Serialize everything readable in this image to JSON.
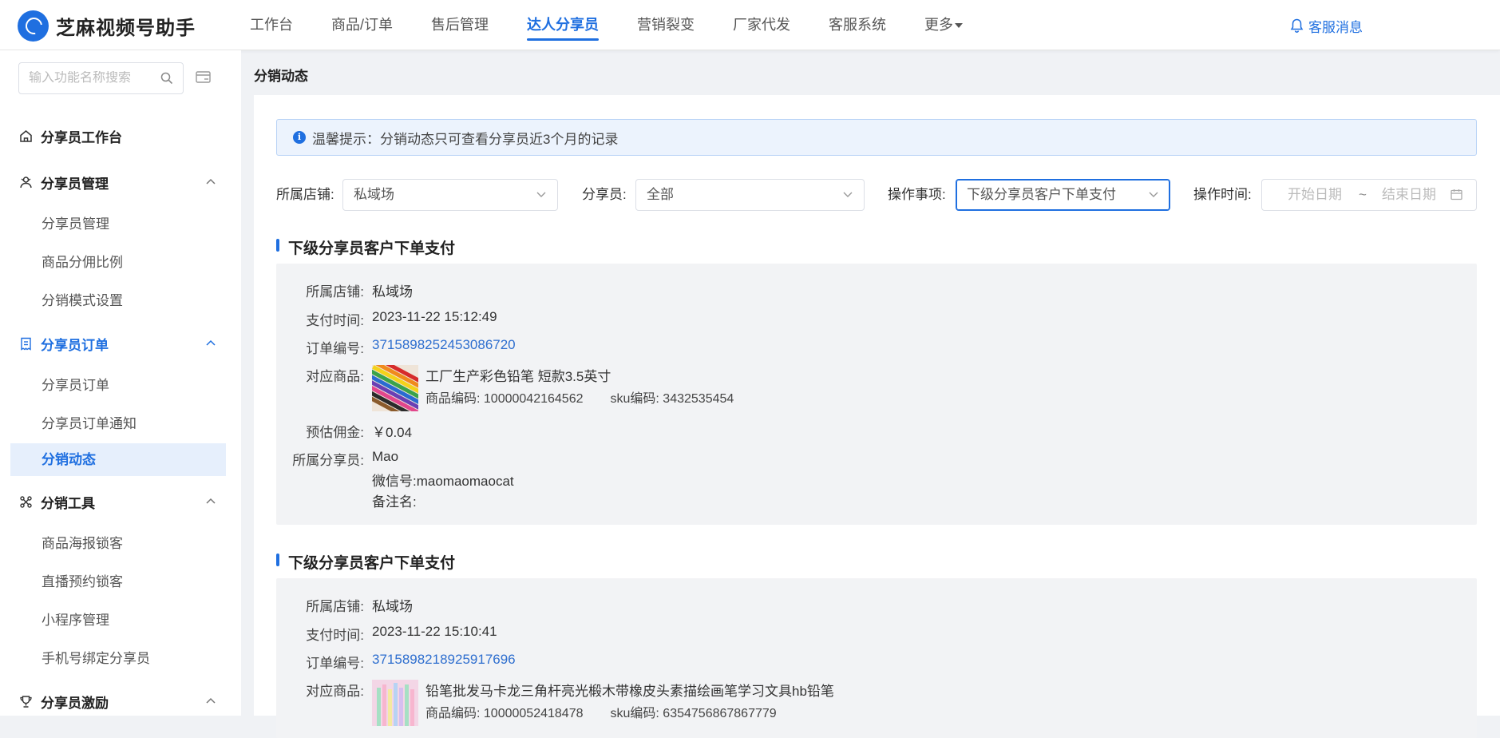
{
  "app": {
    "title": "芝麻视频号助手"
  },
  "nav": {
    "items": [
      "工作台",
      "商品/订单",
      "售后管理",
      "达人分享员",
      "营销裂变",
      "厂家代发",
      "客服系统",
      "更多"
    ],
    "active": 3,
    "service": "客服消息"
  },
  "sidebar": {
    "search_placeholder": "输入功能名称搜索",
    "groups": [
      {
        "label": "分享员工作台",
        "icon": "home-icon"
      },
      {
        "label": "分享员管理",
        "icon": "people-icon",
        "subs": [
          "分享员管理",
          "商品分佣比例",
          "分销模式设置"
        ]
      },
      {
        "label": "分享员订单",
        "icon": "order-icon",
        "subs": [
          "分享员订单",
          "分享员订单通知",
          "分销动态"
        ]
      },
      {
        "label": "分销工具",
        "icon": "tools-icon",
        "subs": [
          "商品海报锁客",
          "直播预约锁客",
          "小程序管理",
          "手机号绑定分享员"
        ]
      },
      {
        "label": "分享员激励",
        "icon": "trophy-icon"
      }
    ]
  },
  "breadcrumb": "分销动态",
  "notice": "温馨提示：分销动态只可查看分享员近3个月的记录",
  "filters": {
    "store_label": "所属店铺:",
    "store_value": "私域场",
    "sharer_label": "分享员:",
    "sharer_value": "全部",
    "action_label": "操作事项:",
    "action_value": "下级分享员客户下单支付",
    "time_label": "操作时间:",
    "start_placeholder": "开始日期",
    "range_sep": "~",
    "end_placeholder": "结束日期"
  },
  "labels": {
    "store": "所属店铺:",
    "pay_time": "支付时间:",
    "order_no": "订单编号:",
    "product": "对应商品:",
    "commission": "预估佣金:",
    "sharer": "所属分享员:",
    "product_code": "商品编码:",
    "sku_code": "sku编码:",
    "wechat": "微信号:",
    "remark": "备注名:"
  },
  "records": [
    {
      "title": "下级分享员客户下单支付",
      "store": "私域场",
      "pay_time": "2023-11-22 15:12:49",
      "order_no": "3715898252453086720",
      "product_name": "工厂生产彩色铅笔 短款3.5英寸",
      "product_code": "10000042164562",
      "sku_code": "3432535454",
      "commission": "￥0.04",
      "sharer_name": "Mao",
      "wechat": "maomaomaocat",
      "remark": ""
    },
    {
      "title": "下级分享员客户下单支付",
      "store": "私域场",
      "pay_time": "2023-11-22 15:10:41",
      "order_no": "3715898218925917696",
      "product_name": "铅笔批发马卡龙三角杆亮光椴木带橡皮头素描绘画笔学习文具hb铅笔",
      "product_code": "10000052418478",
      "sku_code": "6354756867867779"
    }
  ],
  "colors": {
    "accent": "#1f6fe0",
    "link": "#2f6fcf",
    "record_bg": "#f2f3f5",
    "notice_bg": "#ecf3fd"
  }
}
